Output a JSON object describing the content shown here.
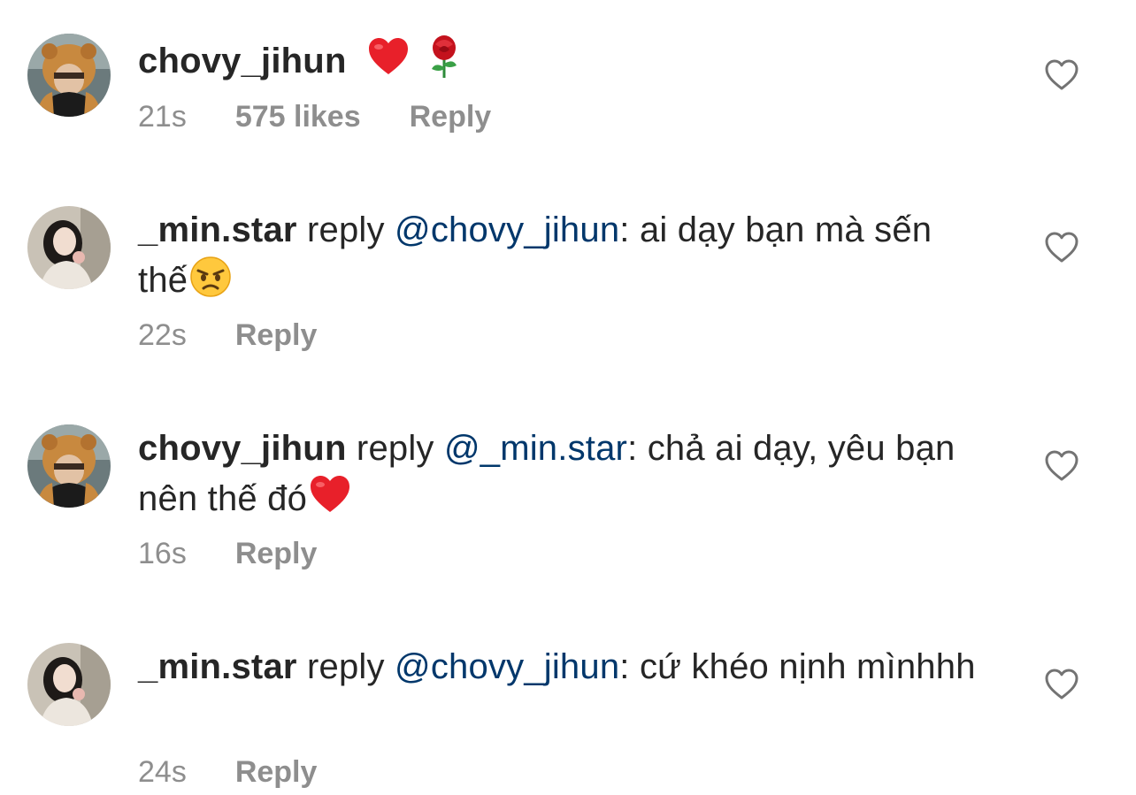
{
  "comments": [
    {
      "username": "chovy_jihun",
      "verb": "",
      "mention": "",
      "separator": "",
      "text": "",
      "emojis": [
        "red-heart-emoji",
        "rose-emoji"
      ],
      "time": "21s",
      "likes": "575 likes",
      "reply_label": "Reply",
      "avatar": "chovy-avatar"
    },
    {
      "username": "_min.star",
      "verb": "reply",
      "mention": "@chovy_jihun",
      "separator": ":",
      "text": "ai dạy bạn mà sến thế",
      "emojis": [
        "angry-face-emoji"
      ],
      "time": "22s",
      "likes": "",
      "reply_label": "Reply",
      "avatar": "minstar-avatar"
    },
    {
      "username": "chovy_jihun",
      "verb": "reply",
      "mention": "@_min.star",
      "separator": ":",
      "text": "chả ai dạy, yêu bạn nên thế đó",
      "emojis": [
        "red-heart-emoji"
      ],
      "time": "16s",
      "likes": "",
      "reply_label": "Reply",
      "avatar": "chovy-avatar"
    },
    {
      "username": "_min.star",
      "verb": "reply",
      "mention": "@chovy_jihun",
      "separator": ":",
      "text": "cứ khéo nịnh mìnhhh",
      "emojis": [],
      "time": "24s",
      "likes": "",
      "reply_label": "Reply",
      "avatar": "minstar-avatar"
    }
  ],
  "colors": {
    "text": "#262626",
    "meta": "#8e8e8e",
    "mention": "#00376b",
    "heart_outline": "#737373"
  }
}
